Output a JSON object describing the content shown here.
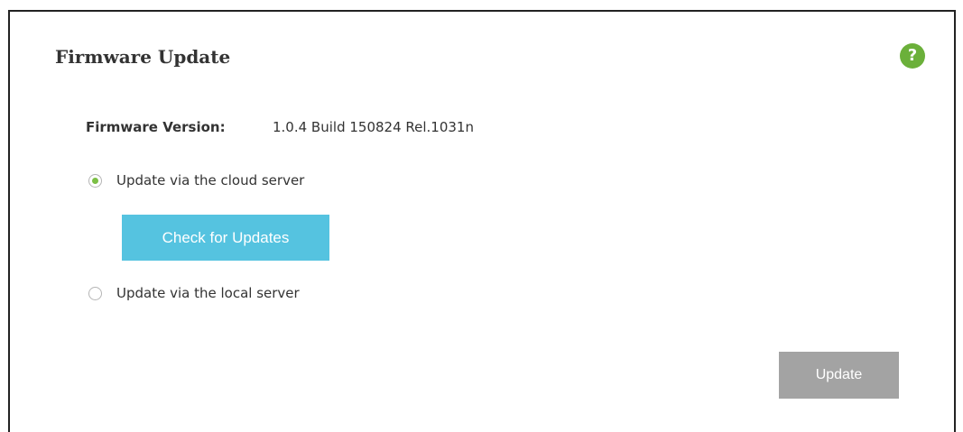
{
  "section": {
    "title": "Firmware Update",
    "help_icon": "question-mark-icon",
    "help_glyph": "?"
  },
  "firmware": {
    "label": "Firmware Version:",
    "version": "1.0.4 Build 150824 Rel.1031n"
  },
  "update_options": [
    {
      "label": "Update via the cloud server",
      "selected": true
    },
    {
      "label": "Update via the local server",
      "selected": false
    }
  ],
  "buttons": {
    "check_updates": "Check for Updates",
    "update": "Update"
  },
  "colors": {
    "help_icon_green": "#6bb03a",
    "radio_selected_green": "#7cbf45",
    "check_button_blue": "#55c3e0",
    "update_button_gray": "#a3a3a3"
  }
}
